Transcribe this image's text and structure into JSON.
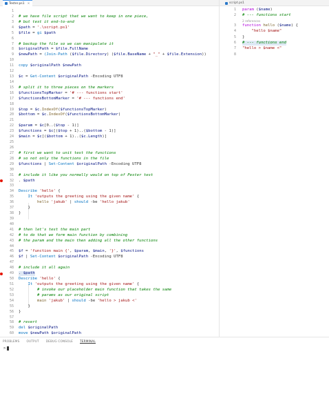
{
  "editor_tabs": {
    "left": {
      "label": "Tester.ps1",
      "close": "×"
    },
    "right": {
      "label": "script.ps1"
    }
  },
  "left_lines": [
    {
      "n": "1",
      "t": []
    },
    {
      "n": "2",
      "t": [
        [
          "c",
          "# we have file script that we want to keep in one piece,"
        ]
      ]
    },
    {
      "n": "3",
      "t": [
        [
          "c",
          "# but test it end-to-end"
        ]
      ]
    },
    {
      "n": "4",
      "t": [
        [
          "v",
          "$path"
        ],
        [
          "op",
          " = "
        ],
        [
          "s",
          "'.\\script.ps1'"
        ]
      ]
    },
    {
      "n": "5",
      "t": [
        [
          "v",
          "$file"
        ],
        [
          "op",
          " = "
        ],
        [
          "cmd",
          "gi"
        ],
        [
          "op",
          " "
        ],
        [
          "v",
          "$path"
        ]
      ]
    },
    {
      "n": "6",
      "t": []
    },
    {
      "n": "7",
      "t": [
        [
          "c",
          "# backup the file so we can manipulate it"
        ]
      ]
    },
    {
      "n": "8",
      "t": [
        [
          "v",
          "$originalPath"
        ],
        [
          "op",
          " = "
        ],
        [
          "v",
          "$file"
        ],
        [
          "op",
          "."
        ],
        [
          "v",
          "FullName"
        ]
      ]
    },
    {
      "n": "9",
      "t": [
        [
          "v",
          "$newPath"
        ],
        [
          "op",
          " = "
        ],
        [
          "cmd",
          "(Join-Path"
        ],
        [
          "op",
          " ("
        ],
        [
          "v",
          "$file"
        ],
        [
          "op",
          "."
        ],
        [
          "v",
          "Directory"
        ],
        [
          "op",
          ") ("
        ],
        [
          "v",
          "$file"
        ],
        [
          "op",
          "."
        ],
        [
          "v",
          "BaseName"
        ],
        [
          "op",
          " + "
        ],
        [
          "s",
          "\"_\""
        ],
        [
          "op",
          " + "
        ],
        [
          "v",
          "$file"
        ],
        [
          "op",
          "."
        ],
        [
          "v",
          "Extension"
        ],
        [
          "op",
          "))"
        ]
      ]
    },
    {
      "n": "10",
      "t": []
    },
    {
      "n": "11",
      "t": [
        [
          "cmd",
          "copy"
        ],
        [
          "op",
          " "
        ],
        [
          "v",
          "$originalPath"
        ],
        [
          "op",
          " "
        ],
        [
          "v",
          "$newPath"
        ]
      ]
    },
    {
      "n": "12",
      "t": []
    },
    {
      "n": "13",
      "t": [
        [
          "v",
          "$c"
        ],
        [
          "op",
          " = "
        ],
        [
          "cmd",
          "Get-Content"
        ],
        [
          "op",
          " "
        ],
        [
          "v",
          "$originalPath"
        ],
        [
          "op",
          " -Encoding UTF8"
        ]
      ]
    },
    {
      "n": "14",
      "t": []
    },
    {
      "n": "15",
      "t": [
        [
          "c",
          "# split it to three pieces on the markers"
        ]
      ]
    },
    {
      "n": "16",
      "t": [
        [
          "v",
          "$functionsTopMarker"
        ],
        [
          "op",
          " = "
        ],
        [
          "s",
          "'# --- functions start'"
        ]
      ]
    },
    {
      "n": "17",
      "t": [
        [
          "v",
          "$functionsBottomMarker"
        ],
        [
          "op",
          " = "
        ],
        [
          "s",
          "'# --- functions end'"
        ]
      ]
    },
    {
      "n": "18",
      "t": []
    },
    {
      "n": "19",
      "t": [
        [
          "v",
          "$top"
        ],
        [
          "op",
          " = "
        ],
        [
          "v",
          "$c"
        ],
        [
          "op",
          "."
        ],
        [
          "f",
          "IndexOf"
        ],
        [
          "op",
          "("
        ],
        [
          "v",
          "$functionsTopMarker"
        ],
        [
          "op",
          ")"
        ]
      ]
    },
    {
      "n": "20",
      "t": [
        [
          "v",
          "$bottom"
        ],
        [
          "op",
          " = "
        ],
        [
          "v",
          "$c"
        ],
        [
          "op",
          "."
        ],
        [
          "f",
          "IndexOf"
        ],
        [
          "op",
          "("
        ],
        [
          "v",
          "$functionsBottomMarker"
        ],
        [
          "op",
          ")"
        ]
      ]
    },
    {
      "n": "21",
      "t": []
    },
    {
      "n": "22",
      "t": [
        [
          "v",
          "$param"
        ],
        [
          "op",
          " = "
        ],
        [
          "v",
          "$c"
        ],
        [
          "op",
          "[0..("
        ],
        [
          "v",
          "$top"
        ],
        [
          "op",
          " - 1)]"
        ]
      ]
    },
    {
      "n": "23",
      "t": [
        [
          "v",
          "$functions"
        ],
        [
          "op",
          " = "
        ],
        [
          "v",
          "$c"
        ],
        [
          "op",
          "[("
        ],
        [
          "v",
          "$top"
        ],
        [
          "op",
          " + 1)..("
        ],
        [
          "v",
          "$bottom"
        ],
        [
          "op",
          " - 1)]"
        ]
      ]
    },
    {
      "n": "24",
      "t": [
        [
          "v",
          "$main"
        ],
        [
          "op",
          " = "
        ],
        [
          "v",
          "$c"
        ],
        [
          "op",
          "[("
        ],
        [
          "v",
          "$bottom"
        ],
        [
          "op",
          " + 1)..("
        ],
        [
          "v",
          "$c"
        ],
        [
          "op",
          "."
        ],
        [
          "v",
          "Length"
        ],
        [
          "op",
          ")]"
        ]
      ]
    },
    {
      "n": "25",
      "t": []
    },
    {
      "n": "26",
      "t": []
    },
    {
      "n": "27",
      "t": [
        [
          "c",
          "# first we want to unit test the functions"
        ]
      ]
    },
    {
      "n": "28",
      "t": [
        [
          "c",
          "# so not only the functions in the file"
        ]
      ]
    },
    {
      "n": "29",
      "t": [
        [
          "v",
          "$functions"
        ],
        [
          "op",
          " | "
        ],
        [
          "cmd",
          "Set-Content"
        ],
        [
          "op",
          " "
        ],
        [
          "v",
          "$originalPath"
        ],
        [
          "op",
          " -Encoding UTF8"
        ]
      ]
    },
    {
      "n": "30",
      "t": []
    },
    {
      "n": "31",
      "t": [
        [
          "c",
          "# include it like you normally would on top of Pester test"
        ]
      ]
    },
    {
      "n": "32",
      "t": [
        [
          "op",
          ". "
        ],
        [
          "v",
          "$path"
        ]
      ],
      "bp": true
    },
    {
      "n": "33",
      "t": []
    },
    {
      "n": "34",
      "t": [
        [
          "cmd",
          "Describe"
        ],
        [
          "op",
          " "
        ],
        [
          "s",
          "'hello'"
        ],
        [
          "op",
          " {"
        ]
      ]
    },
    {
      "n": "35",
      "t": [
        [
          "op",
          "    "
        ],
        [
          "cmd",
          "It"
        ],
        [
          "op",
          " "
        ],
        [
          "s",
          "'outputs the greeting using the given name'"
        ],
        [
          "op",
          " {"
        ]
      ]
    },
    {
      "n": "36",
      "t": [
        [
          "op",
          "        "
        ],
        [
          "f",
          "hello"
        ],
        [
          "op",
          " "
        ],
        [
          "s",
          "'jakub'"
        ],
        [
          "op",
          " | "
        ],
        [
          "cmd",
          "should"
        ],
        [
          "op",
          " -be "
        ],
        [
          "s",
          "'hello jakub'"
        ]
      ]
    },
    {
      "n": "37",
      "t": [
        [
          "op",
          "    }"
        ]
      ]
    },
    {
      "n": "38",
      "t": [
        [
          "op",
          "}"
        ]
      ]
    },
    {
      "n": "39",
      "t": []
    },
    {
      "n": "40",
      "t": []
    },
    {
      "n": "41",
      "t": [
        [
          "c",
          "# then let's test the main part"
        ]
      ]
    },
    {
      "n": "42",
      "t": [
        [
          "c",
          "# to do that we form main function by combining"
        ]
      ]
    },
    {
      "n": "43",
      "t": [
        [
          "c",
          "# the param and the main then adding all the other functions"
        ]
      ]
    },
    {
      "n": "44",
      "t": []
    },
    {
      "n": "45",
      "t": [
        [
          "v",
          "$f"
        ],
        [
          "op",
          " = "
        ],
        [
          "s",
          "'function main {'"
        ],
        [
          "op",
          ", "
        ],
        [
          "v",
          "$param"
        ],
        [
          "op",
          ", "
        ],
        [
          "v",
          "$main"
        ],
        [
          "op",
          ", "
        ],
        [
          "s",
          "'}'"
        ],
        [
          "op",
          ", "
        ],
        [
          "v",
          "$functions"
        ]
      ]
    },
    {
      "n": "46",
      "t": [
        [
          "v",
          "$f"
        ],
        [
          "op",
          " | "
        ],
        [
          "cmd",
          "Set-Content"
        ],
        [
          "op",
          " "
        ],
        [
          "v",
          "$originalPath"
        ],
        [
          "op",
          " -Encoding UTF8"
        ]
      ]
    },
    {
      "n": "47",
      "t": []
    },
    {
      "n": "48",
      "t": [
        [
          "c",
          "# include it all again"
        ]
      ]
    },
    {
      "n": "49",
      "t": [
        [
          "op",
          ". "
        ],
        [
          "v",
          "$path"
        ]
      ],
      "bp": true,
      "hl": true
    },
    {
      "n": "50",
      "t": [
        [
          "cmd",
          "Describe"
        ],
        [
          "op",
          " "
        ],
        [
          "s",
          "'hello'"
        ],
        [
          "op",
          " {"
        ]
      ]
    },
    {
      "n": "51",
      "t": [
        [
          "op",
          "    "
        ],
        [
          "cmd",
          "It"
        ],
        [
          "op",
          " "
        ],
        [
          "s",
          "'outputs the greeting using the given name'"
        ],
        [
          "op",
          " {"
        ]
      ]
    },
    {
      "n": "52",
      "t": [
        [
          "op",
          "        "
        ],
        [
          "c",
          "# invoke our placeholder main function that takes the same"
        ]
      ]
    },
    {
      "n": "53",
      "t": [
        [
          "op",
          "        "
        ],
        [
          "c",
          "# params as our original script"
        ]
      ]
    },
    {
      "n": "54",
      "t": [
        [
          "op",
          "        "
        ],
        [
          "f",
          "main"
        ],
        [
          "op",
          " "
        ],
        [
          "s",
          "'jakub'"
        ],
        [
          "op",
          " | "
        ],
        [
          "cmd",
          "should"
        ],
        [
          "op",
          " -be "
        ],
        [
          "s",
          "'hello > jakub <'"
        ]
      ]
    },
    {
      "n": "55",
      "t": [
        [
          "op",
          "    }"
        ]
      ]
    },
    {
      "n": "56",
      "t": [
        [
          "op",
          "}"
        ]
      ]
    },
    {
      "n": "57",
      "t": []
    },
    {
      "n": "58",
      "t": [
        [
          "c",
          "# revert"
        ]
      ]
    },
    {
      "n": "59",
      "t": [
        [
          "cmd",
          "del"
        ],
        [
          "op",
          " "
        ],
        [
          "v",
          "$originalPath"
        ]
      ]
    },
    {
      "n": "60",
      "t": [
        [
          "cmd",
          "move"
        ],
        [
          "op",
          " "
        ],
        [
          "v",
          "$newPath"
        ],
        [
          "op",
          " "
        ],
        [
          "v",
          "$originalPath"
        ]
      ]
    }
  ],
  "right_lines": [
    {
      "n": "1",
      "t": [
        [
          "k",
          "param"
        ],
        [
          "op",
          " ("
        ],
        [
          "v",
          "$name"
        ],
        [
          "op",
          ")"
        ]
      ]
    },
    {
      "n": "2",
      "t": [
        [
          "c",
          "# --- functions start"
        ]
      ]
    },
    {
      "lens": "2 references"
    },
    {
      "n": "3",
      "t": [
        [
          "k",
          "function"
        ],
        [
          "op",
          " "
        ],
        [
          "f",
          "hello"
        ],
        [
          "op",
          " ("
        ],
        [
          "v",
          "$name"
        ],
        [
          "op",
          ") {"
        ]
      ]
    },
    {
      "n": "4",
      "t": [
        [
          "op",
          "    "
        ],
        [
          "s",
          "\"hello $name\""
        ]
      ]
    },
    {
      "n": "5",
      "t": [
        [
          "op",
          "}"
        ]
      ]
    },
    {
      "n": "6",
      "t": [
        [
          "c",
          "# --- functions end"
        ]
      ],
      "hl": true
    },
    {
      "n": "7",
      "t": [
        [
          "s",
          "\"hello > $name <\""
        ]
      ]
    },
    {
      "n": "8",
      "t": []
    }
  ],
  "panel": {
    "tabs": [
      "PROBLEMS",
      "OUTPUT",
      "DEBUG CONSOLE",
      "TERMINAL"
    ],
    "active_tab": "TERMINAL",
    "prompt": ">"
  },
  "colors": {
    "breakpoint": "#e51400",
    "comment": "#008000",
    "string": "#a31515",
    "variable": "#001080",
    "command": "#0070c1",
    "keyword": "#af00db",
    "accent": "#3c8ee8"
  }
}
